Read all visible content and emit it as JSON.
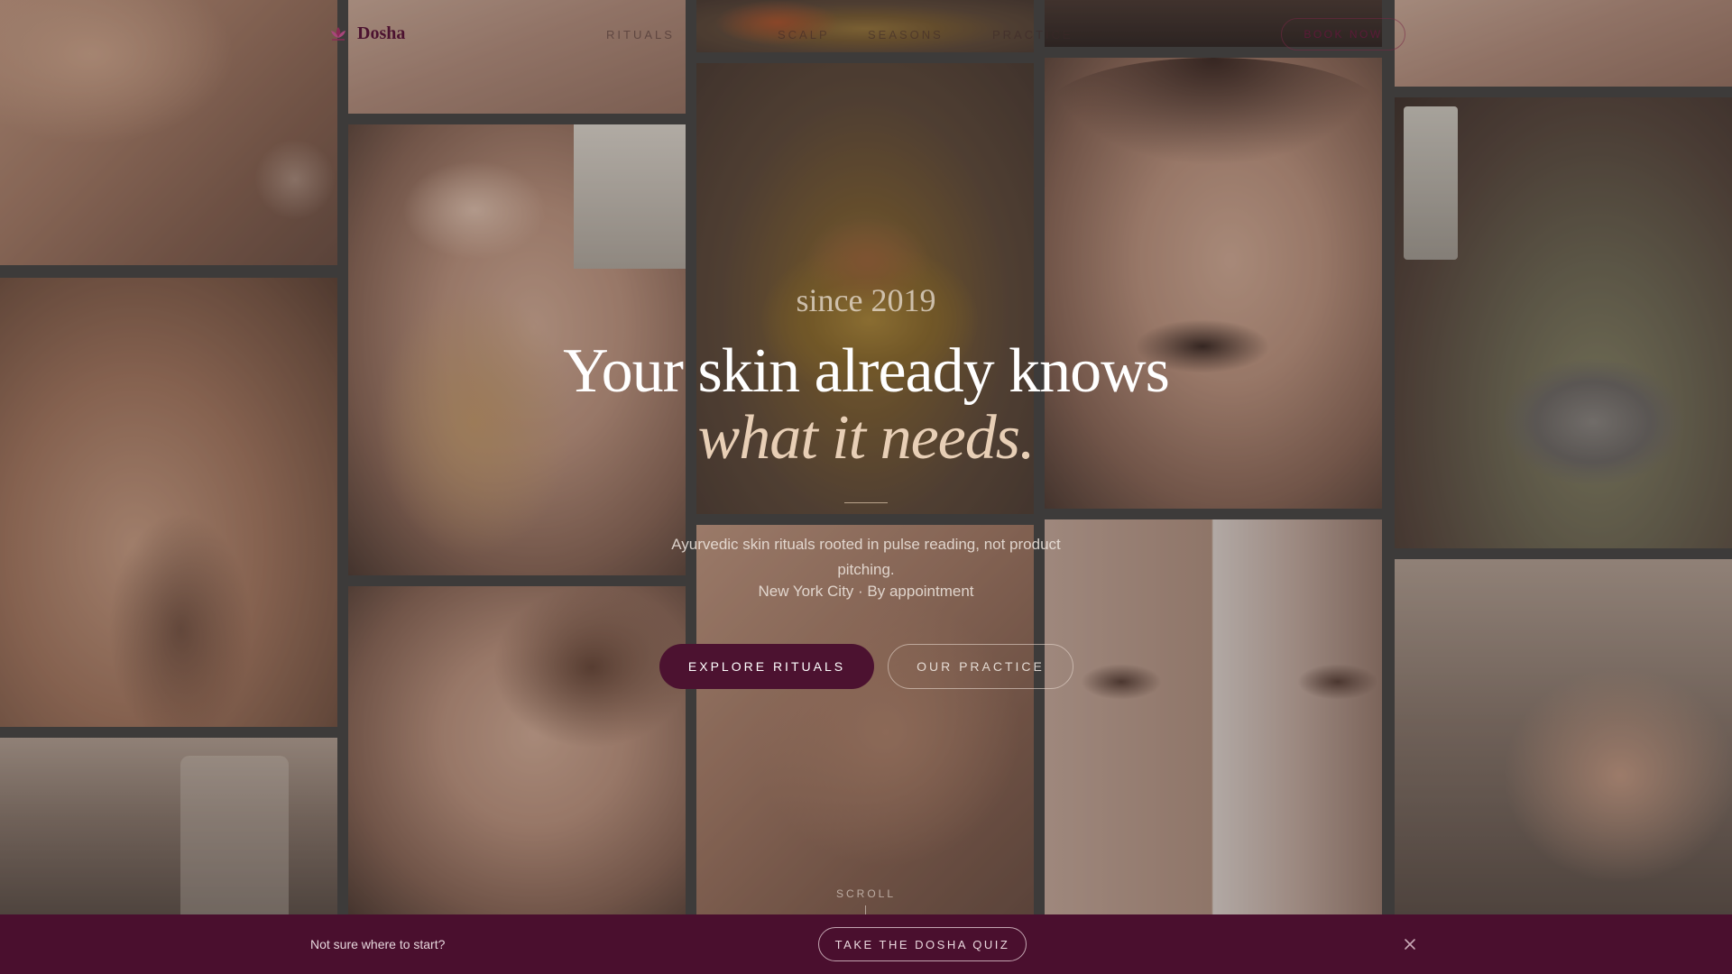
{
  "brand": {
    "name": "Dosha",
    "logo_icon": "lotus-icon"
  },
  "nav": {
    "links": [
      {
        "label": "RITUALS"
      },
      {
        "label": "SCALP"
      },
      {
        "label": "SEASONS"
      },
      {
        "label": "PRACTICE"
      }
    ],
    "cta_label": "BOOK NOW"
  },
  "hero": {
    "overline": "since 2019",
    "headline_line1": "Your skin already knows",
    "headline_line2": "what it needs.",
    "subtitle": "Ayurvedic skin rituals rooted in pulse reading, not product pitching.",
    "location": "New York City · By appointment",
    "primary_button": "EXPLORE RITUALS",
    "secondary_button": "OUR PRACTICE",
    "scroll_label": "SCROLL"
  },
  "quiz_bar": {
    "text": "Not sure where to start?",
    "button": "TAKE THE DOSHA QUIZ",
    "close_icon": "close-icon"
  },
  "colors": {
    "brand": "#4c1230",
    "quiz_bar_bg": "#4a0f2e",
    "accent_italic": "#e8cfb6",
    "gutter": "#3d3b3a"
  }
}
